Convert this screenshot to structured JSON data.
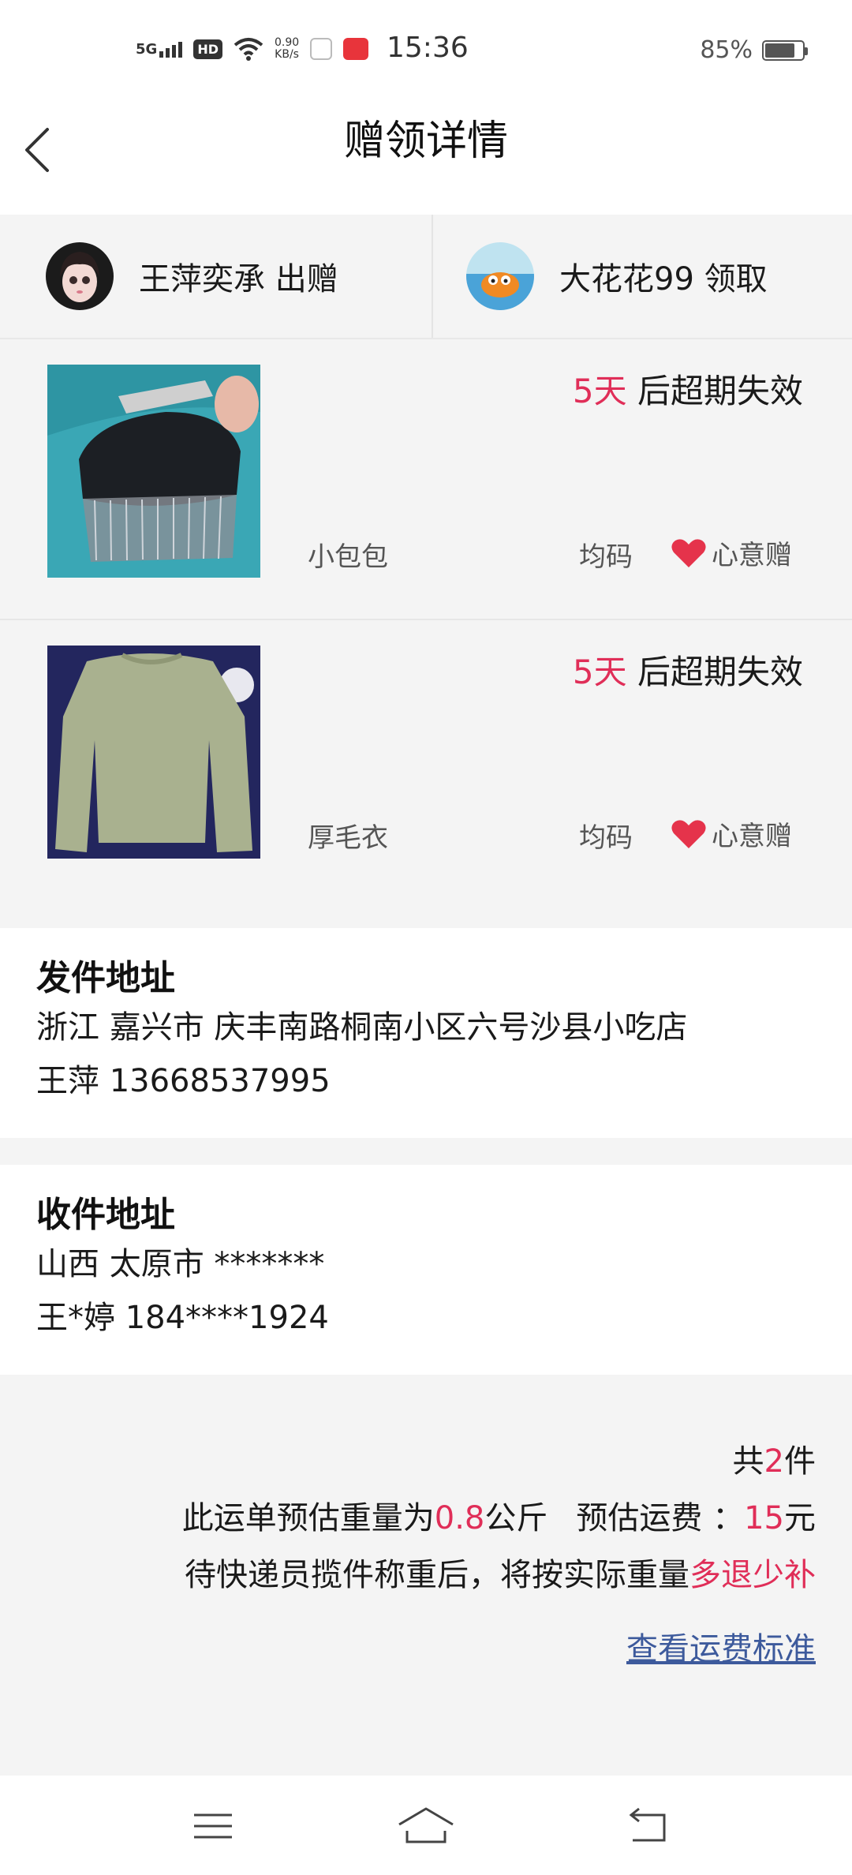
{
  "status_bar": {
    "signal": "5G",
    "hd": "HD",
    "speed_value": "0.90",
    "speed_unit": "KB/s",
    "time": "15:36",
    "battery": "85%"
  },
  "nav": {
    "title": "赠领详情"
  },
  "giver": {
    "name": "王萍奕承 出赠"
  },
  "receiver": {
    "name": "大花花99 领取"
  },
  "items": [
    {
      "expire_days": "5天",
      "expire_suffix": " 后超期失效",
      "name": "小包包",
      "size": "均码",
      "tag": "心意赠"
    },
    {
      "expire_days": "5天",
      "expire_suffix": " 后超期失效",
      "name": "厚毛衣",
      "size": "均码",
      "tag": "心意赠"
    }
  ],
  "sender_address": {
    "title": "发件地址",
    "address": "浙江 嘉兴市 庆丰南路桐南小区六号沙县小吃店",
    "contact": "王萍 13668537995"
  },
  "receiver_address": {
    "title": "收件地址",
    "address": "山西 太原市 *******",
    "contact": "王*婷 184****1924"
  },
  "summary": {
    "count_prefix": "共",
    "count": "2",
    "count_suffix": "件",
    "weight_prefix": "此运单预估重量为",
    "weight": "0.8",
    "weight_unit": "公斤",
    "fee_prefix": "预估运费 ：",
    "fee": "15",
    "fee_unit": "元",
    "note_prefix": "待快递员揽件称重后，将按实际重量",
    "note_highlight": "多退少补",
    "link": "查看运费标准"
  },
  "colors": {
    "accent_red": "#e02e58",
    "link_blue": "#3d5a9c",
    "background": "#f4f4f4"
  }
}
